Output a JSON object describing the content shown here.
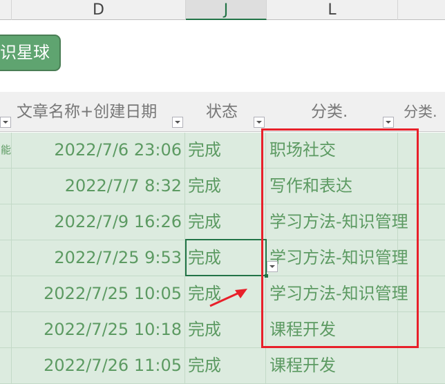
{
  "columns": [
    {
      "label": "D"
    },
    {
      "label": "J"
    },
    {
      "label": "L"
    }
  ],
  "button": {
    "label": "识星球"
  },
  "headers": {
    "date": "文章名称+创建日期",
    "status": "状态",
    "cat1": "分类.",
    "cat2": "分类."
  },
  "rows": [
    {
      "left": "能",
      "date": "2022/7/6 23:06",
      "status": "完成",
      "category": "职场社交"
    },
    {
      "left": "",
      "date": "2022/7/7 8:32",
      "status": "完成",
      "category": "写作和表达"
    },
    {
      "left": "",
      "date": "2022/7/9 16:26",
      "status": "完成",
      "category": "学习方法-知识管理"
    },
    {
      "left": "",
      "date": "2022/7/25 9:53",
      "status": "完成",
      "category": "学习方法-知识管理"
    },
    {
      "left": "",
      "date": "2022/7/25 10:05",
      "status": "完成",
      "category": "学习方法-知识管理"
    },
    {
      "left": "",
      "date": "2022/7/25 10:18",
      "status": "完成",
      "category": "课程开发"
    },
    {
      "left": "",
      "date": "2022/7/26 11:05",
      "status": "完成",
      "category": "课程开发"
    }
  ],
  "colors": {
    "highlight": "#e8202a",
    "accent": "#217346",
    "row_bg": "#dcebdf"
  }
}
